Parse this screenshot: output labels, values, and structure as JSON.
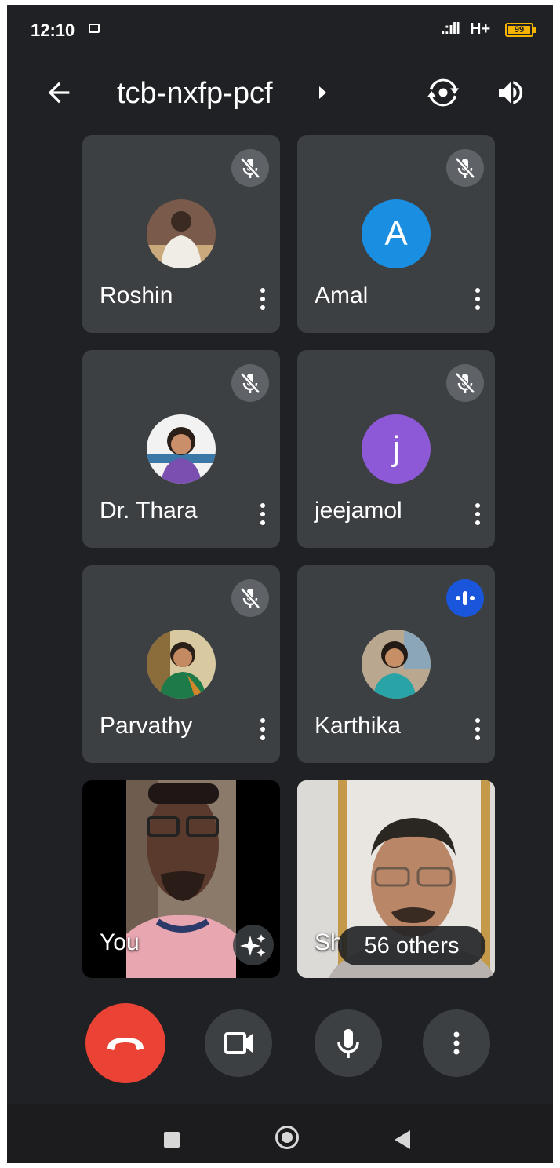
{
  "status_bar": {
    "time": "12:10",
    "signal": ".:ıll",
    "network": "H+",
    "battery": "99"
  },
  "header": {
    "meeting_code": "tcb-nxfp-pcf",
    "icons": [
      "back-arrow-icon",
      "caret-right-icon",
      "switch-camera-icon",
      "speaker-icon"
    ]
  },
  "participants": [
    {
      "name": "Roshin",
      "avatar": "photo",
      "mic": "muted"
    },
    {
      "name": "Amal",
      "avatar": "A",
      "avatar_color": "#1a8ee0",
      "mic": "muted"
    },
    {
      "name": "Dr. Thara",
      "avatar": "photo",
      "mic": "muted"
    },
    {
      "name": "jeejamol",
      "avatar": "j",
      "avatar_color": "#8e59d6",
      "mic": "muted"
    },
    {
      "name": "Parvathy",
      "avatar": "photo",
      "mic": "muted"
    },
    {
      "name": "Karthika",
      "avatar": "photo",
      "mic": "speaking"
    }
  ],
  "self_tile": {
    "label": "You"
  },
  "others_tile": {
    "name_peek": "Sh",
    "others_label": "56 others"
  },
  "controls": {
    "end_call_color": "#ea4335",
    "buttons": [
      "end-call-icon",
      "camera-icon",
      "microphone-icon",
      "more-options-icon"
    ]
  },
  "nav": [
    "square-icon",
    "home-circle-icon",
    "back-triangle-icon"
  ]
}
